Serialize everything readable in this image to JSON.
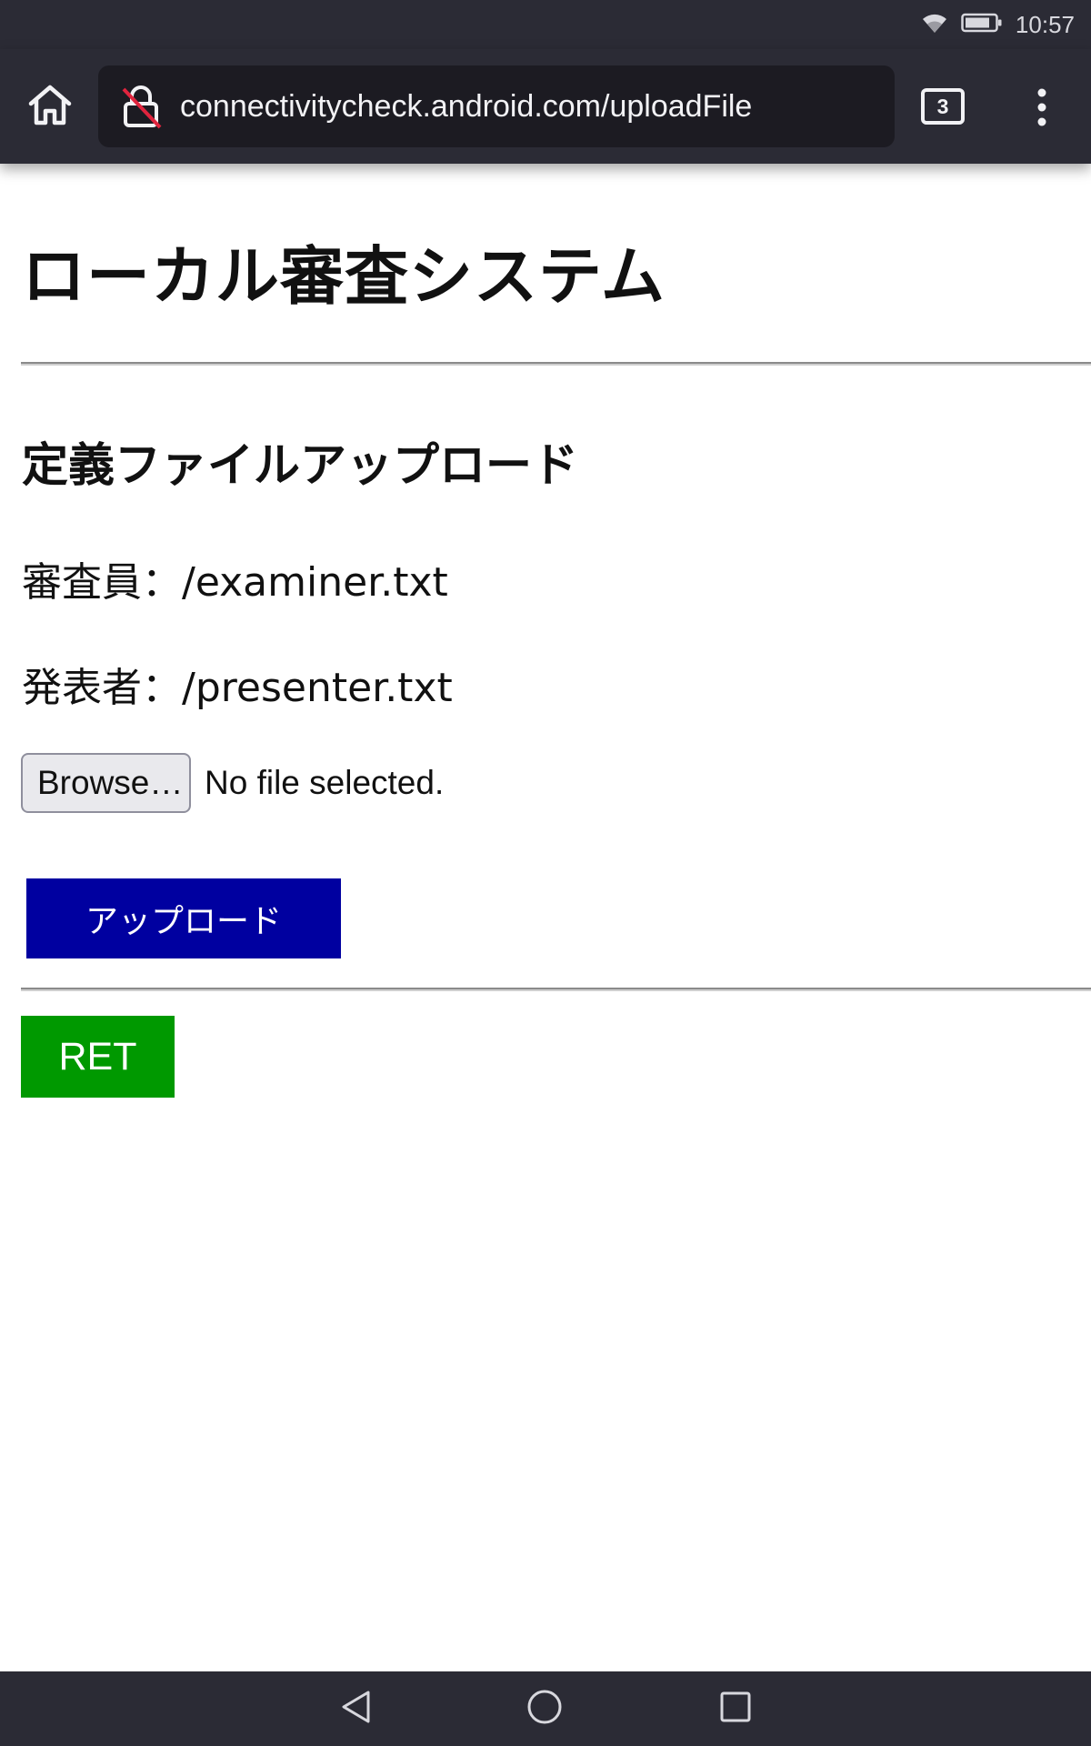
{
  "status_bar": {
    "time": "10:57",
    "icons": [
      "wifi-icon",
      "battery-icon"
    ]
  },
  "browser": {
    "url": "connectivitycheck.android.com/uploadFile",
    "tab_count": "3",
    "icons": [
      "home-icon",
      "insecure-lock-icon",
      "more-vert-icon"
    ]
  },
  "page": {
    "title": "ローカル審査システム",
    "section_title": "定義ファイルアップロード",
    "examiner_line": "審査員：/examiner.txt",
    "presenter_line": "発表者：/presenter.txt",
    "file_input": {
      "button_label": "Browse…",
      "status": "No file selected."
    },
    "upload_button": "アップロード",
    "ret_button": "RET",
    "colors": {
      "upload_button_bg": "#0000a0",
      "ret_button_bg": "#009900",
      "chrome_bg": "#2b2b35"
    }
  },
  "nav_bar": {
    "icons": [
      "back-icon",
      "home-circle-icon",
      "recents-icon"
    ]
  }
}
